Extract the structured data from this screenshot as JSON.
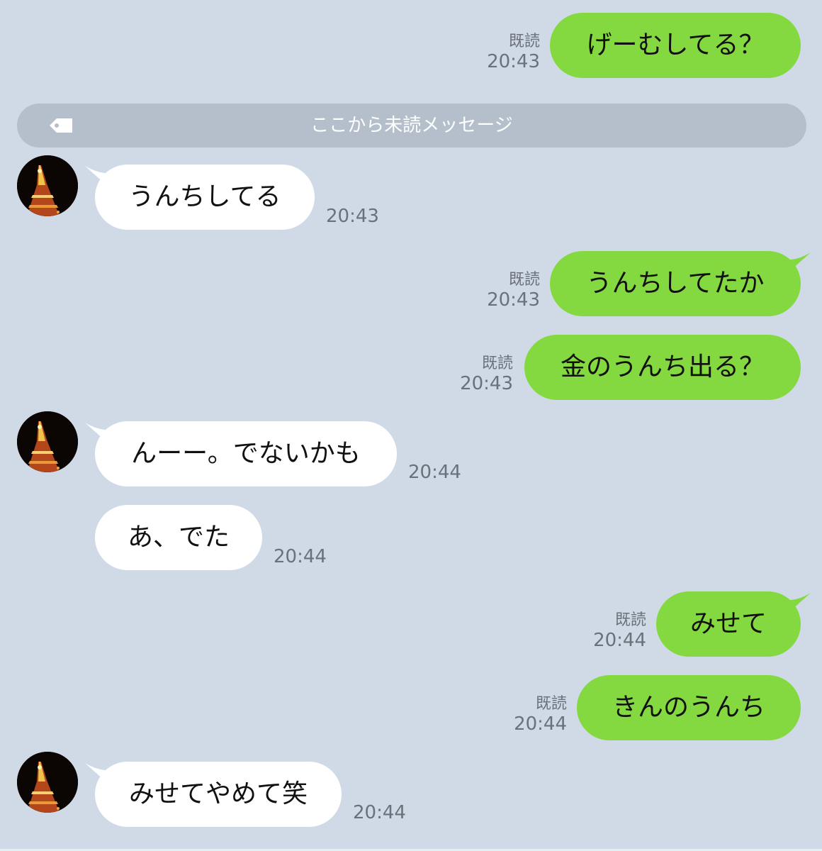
{
  "unread_divider": "ここから未読メッセージ",
  "read_label": "既読",
  "messages": [
    {
      "from": "me",
      "text": "げーむしてる？",
      "read": "既読",
      "time": "20:43"
    },
    {
      "from": "them",
      "text": "うんちしてる",
      "time": "20:43"
    },
    {
      "from": "me",
      "text": "うんちしてたか",
      "read": "既読",
      "time": "20:43"
    },
    {
      "from": "me",
      "text": "金のうんち出る？",
      "read": "既読",
      "time": "20:43"
    },
    {
      "from": "them",
      "text": "んーー。でないかも",
      "time": "20:44"
    },
    {
      "from": "them",
      "text": "あ、でた",
      "time": "20:44"
    },
    {
      "from": "me",
      "text": "みせて",
      "read": "既読",
      "time": "20:44"
    },
    {
      "from": "me",
      "text": "きんのうんち",
      "read": "既読",
      "time": "20:44"
    },
    {
      "from": "them",
      "text": "みせてやめて笑",
      "time": "20:44"
    }
  ],
  "colors": {
    "background": "#d0dae6",
    "my_bubble": "#85d940",
    "their_bubble": "#ffffff",
    "divider": "#b4bfcb",
    "meta_text": "#6a717b"
  },
  "icons": {
    "divider": "tag-icon",
    "avatar": "tokyo-tower-night-photo"
  }
}
